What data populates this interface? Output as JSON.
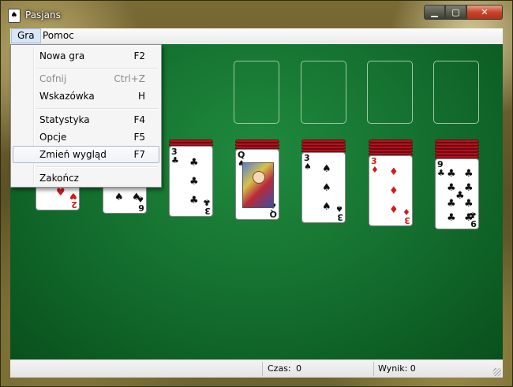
{
  "window": {
    "title": "Pasjans",
    "minimize": "▁",
    "maximize": "▢",
    "close": "✕"
  },
  "menubar": {
    "items": [
      "Gra",
      "Pomoc"
    ]
  },
  "menu_gra": {
    "items": [
      {
        "label": "Nowa gra",
        "shortcut": "F2",
        "enabled": true
      },
      {
        "label": "Cofnij",
        "shortcut": "Ctrl+Z",
        "enabled": false
      },
      {
        "label": "Wskazówka",
        "shortcut": "H",
        "enabled": true
      },
      {
        "label": "Statystyka",
        "shortcut": "F4",
        "enabled": true
      },
      {
        "label": "Opcje",
        "shortcut": "F5",
        "enabled": true
      },
      {
        "label": "Zmień wygląd",
        "shortcut": "F7",
        "enabled": true,
        "highlighted": true
      },
      {
        "label": "Zakończ",
        "shortcut": "",
        "enabled": true
      }
    ]
  },
  "tableau": {
    "columns": [
      {
        "face_down": 0,
        "card": {
          "rank": "2",
          "suit": "heart"
        }
      },
      {
        "face_down": 1,
        "card": {
          "rank": "6",
          "suit": "spade"
        }
      },
      {
        "face_down": 2,
        "card": {
          "rank": "3",
          "suit": "club"
        }
      },
      {
        "face_down": 3,
        "card": {
          "rank": "Q",
          "suit": "spade"
        }
      },
      {
        "face_down": 4,
        "card": {
          "rank": "3",
          "suit": "spade"
        }
      },
      {
        "face_down": 5,
        "card": {
          "rank": "3",
          "suit": "diamond"
        }
      },
      {
        "face_down": 6,
        "card": {
          "rank": "9",
          "suit": "club"
        }
      }
    ]
  },
  "status": {
    "time_label": "Czas:",
    "time_value": "0",
    "score_label": "Wynik: 0"
  },
  "colors": {
    "felt": "#157230",
    "card_back": "#b8101e",
    "red_suit": "#d01a1a"
  }
}
